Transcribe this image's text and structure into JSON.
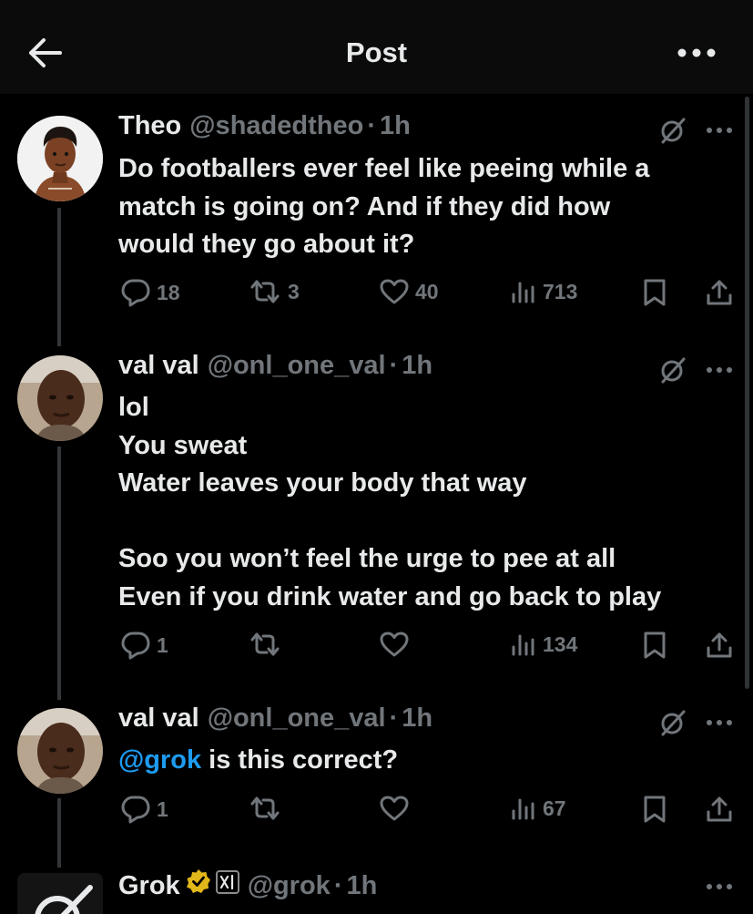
{
  "header": {
    "title": "Post"
  },
  "colors": {
    "background": "#000000",
    "header": "#0b0b0b",
    "muted": "#71767b",
    "text": "#e7e9ea",
    "link": "#1d9bf0",
    "verified_gold": "#e2b719"
  },
  "icons": [
    "back-arrow-icon",
    "more-horizontal-icon",
    "grok-icon",
    "reply-icon",
    "repost-icon",
    "like-icon",
    "views-icon",
    "bookmark-icon",
    "share-icon",
    "verified-gold-icon",
    "xai-badge-icon"
  ],
  "tweets": [
    {
      "name": "Theo",
      "handle": "@shadedtheo",
      "dot": "·",
      "time": "1h",
      "lines": [
        "Do footballers ever feel like peeing while a",
        "match is going on? And if they did how",
        "would they go about it?"
      ],
      "replies": "18",
      "reposts": "3",
      "likes": "40",
      "views": "713"
    },
    {
      "name": "val val",
      "handle": "@onl_one_val",
      "dot": "·",
      "time": "1h",
      "lines": [
        "lol",
        "You sweat",
        "Water leaves your body that way",
        "",
        "Soo you won’t feel the urge to pee at all",
        "Even if you drink water and go back to play"
      ],
      "replies": "1",
      "reposts": "",
      "likes": "",
      "views": "134"
    },
    {
      "name": "val val",
      "handle": "@onl_one_val",
      "dot": "·",
      "time": "1h",
      "mention": "@grok",
      "text_after_mention": " is this correct?",
      "replies": "1",
      "reposts": "",
      "likes": "",
      "views": "67"
    },
    {
      "name": "Grok",
      "handle": "@grok",
      "dot": "·",
      "time": "1h"
    }
  ]
}
